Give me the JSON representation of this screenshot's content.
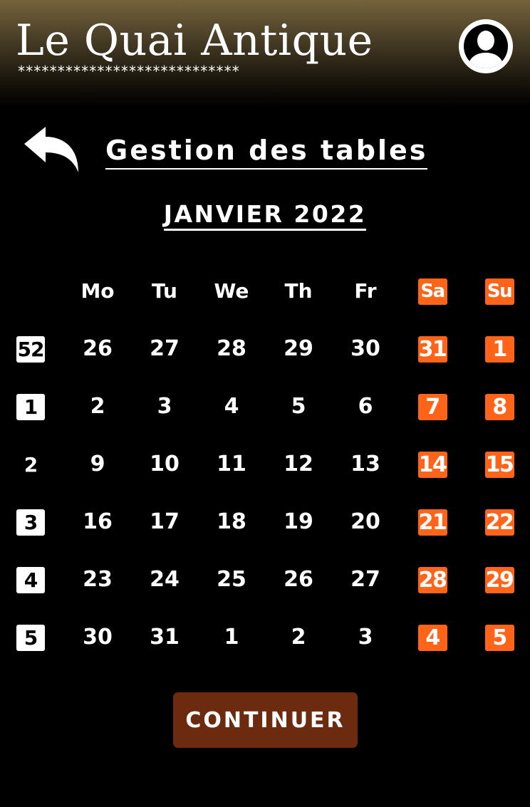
{
  "header": {
    "brand": "Le Quai Antique",
    "stars": "****************************",
    "avatar_icon": "user-avatar-icon"
  },
  "page": {
    "back_icon": "reply-arrow-icon",
    "title": "Gestion des tables"
  },
  "calendar": {
    "month_label": "JANVIER 2022",
    "day_headers": [
      "Mo",
      "Tu",
      "We",
      "Th",
      "Fr",
      "Sa",
      "Su"
    ],
    "weekend_color": "#ff6419",
    "weeks": [
      {
        "week": "52",
        "days": [
          "26",
          "27",
          "28",
          "29",
          "30",
          "31",
          "1"
        ]
      },
      {
        "week": "1",
        "days": [
          "2",
          "3",
          "4",
          "5",
          "6",
          "7",
          "8"
        ]
      },
      {
        "week": "2",
        "days": [
          "9",
          "10",
          "11",
          "12",
          "13",
          "14",
          "15"
        ]
      },
      {
        "week": "3",
        "days": [
          "16",
          "17",
          "18",
          "19",
          "20",
          "21",
          "22"
        ]
      },
      {
        "week": "4",
        "days": [
          "23",
          "24",
          "25",
          "26",
          "27",
          "28",
          "29"
        ]
      },
      {
        "week": "5",
        "days": [
          "30",
          "31",
          "1",
          "2",
          "3",
          "4",
          "5"
        ]
      }
    ]
  },
  "actions": {
    "continue_label": "CONTINUER",
    "continue_color": "#6c2a0f"
  }
}
